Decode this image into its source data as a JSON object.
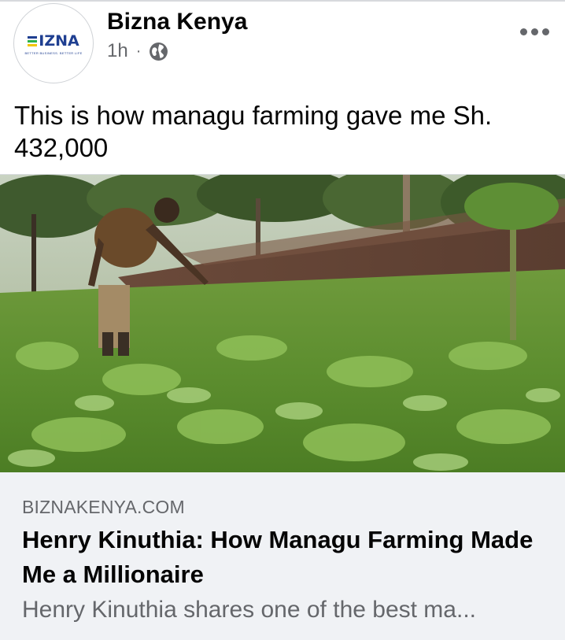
{
  "header": {
    "page_name": "Bizna Kenya",
    "time": "1h",
    "separator": "·",
    "audience_icon": "globe-icon",
    "more_icon": "more-options-icon"
  },
  "avatar": {
    "logo_text": "IZNA",
    "logo_tagline": "BETTER BUSINESS. BETTER LIFE",
    "colors": [
      "#1f3f91",
      "#2bb24c",
      "#f2c500"
    ]
  },
  "post": {
    "text": "This is how managu farming gave me Sh. 432,000"
  },
  "link_preview": {
    "domain": "BIZNAKENYA.COM",
    "title": "Henry Kinuthia: How Managu Farming Made Me a Millionaire",
    "description": "Henry Kinuthia shares one of the best ma..."
  },
  "colors": {
    "primary_text": "#050505",
    "secondary_text": "#65676b",
    "link_box_bg": "#f0f2f5",
    "brand_blue": "#1f3f91"
  }
}
